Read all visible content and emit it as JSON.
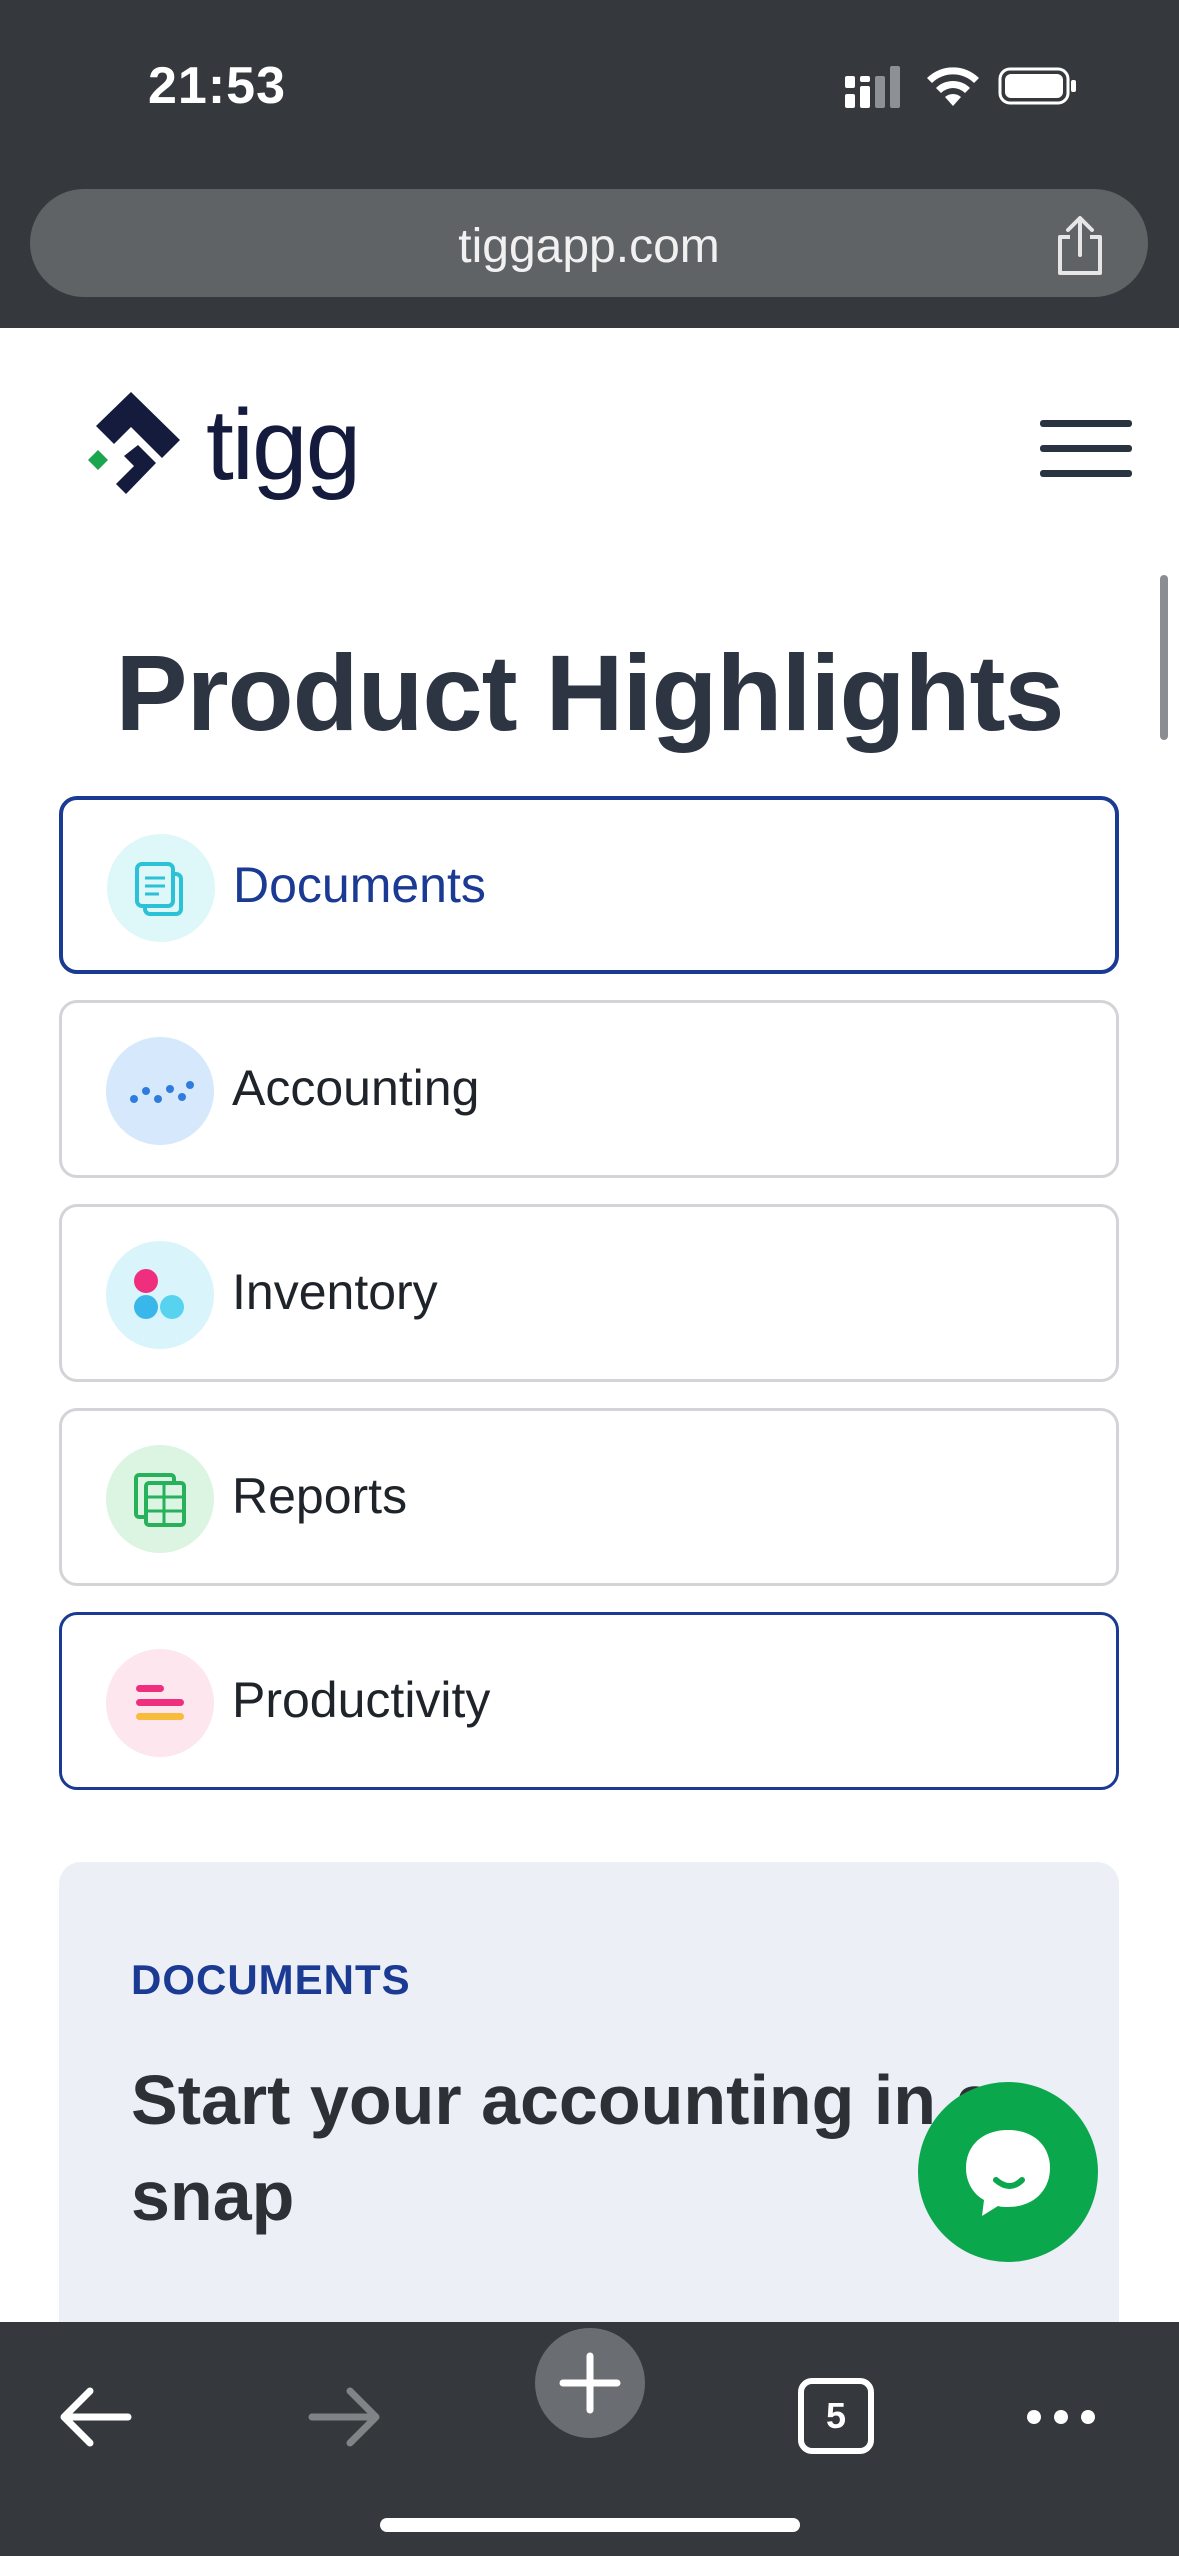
{
  "status_bar": {
    "time": "21:53"
  },
  "browser": {
    "url": "tiggapp.com",
    "tab_count": "5"
  },
  "brand": {
    "name": "tigg",
    "accent": "#1a3a93",
    "green": "#0aa74c"
  },
  "page": {
    "title": "Product Highlights",
    "features": [
      {
        "label": "Documents",
        "icon": "documents-icon",
        "selected": true
      },
      {
        "label": "Accounting",
        "icon": "accounting-icon",
        "selected": false
      },
      {
        "label": "Inventory",
        "icon": "inventory-icon",
        "selected": false
      },
      {
        "label": "Reports",
        "icon": "reports-icon",
        "selected": false
      },
      {
        "label": "Productivity",
        "icon": "productivity-icon",
        "selected": false
      }
    ],
    "panel": {
      "eyebrow": "DOCUMENTS",
      "heading": "Start your accounting in a snap"
    }
  }
}
